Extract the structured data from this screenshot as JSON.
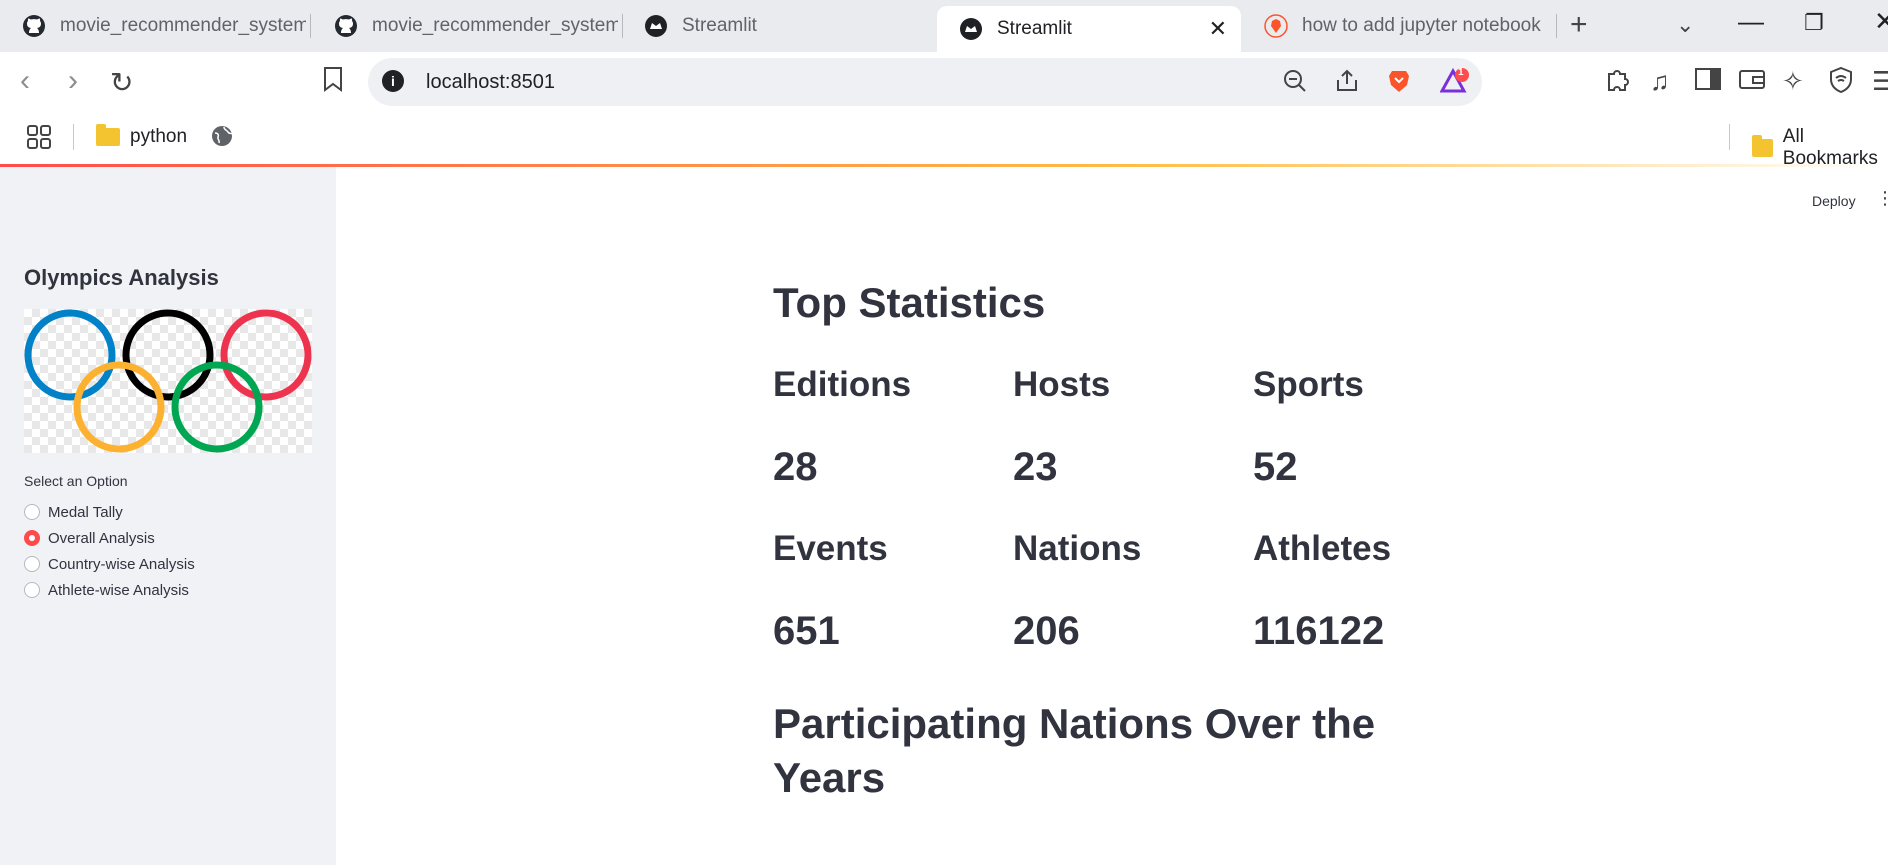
{
  "browser": {
    "tabs": [
      {
        "title": "movie_recommender_system/",
        "icon": "github-icon"
      },
      {
        "title": "movie_recommender_system/",
        "icon": "github-icon"
      },
      {
        "title": "Streamlit",
        "icon": "streamlit-icon"
      },
      {
        "title": "Streamlit",
        "icon": "streamlit-icon",
        "active": true
      },
      {
        "title": "how to add jupyter notebook",
        "icon": "brave-icon"
      }
    ],
    "url": "localhost:8501",
    "notification_count": "1",
    "bookmarks": [
      {
        "label": "python"
      },
      {
        "label": "All Bookmarks"
      }
    ]
  },
  "app": {
    "toolbar": {
      "deploy_label": "Deploy"
    },
    "sidebar": {
      "title": "Olympics Analysis",
      "radio_label": "Select an Option",
      "options": [
        "Medal Tally",
        "Overall Analysis",
        "Country-wise Analysis",
        "Athlete-wise Analysis"
      ],
      "selected": "Overall Analysis"
    },
    "main": {
      "title": "Top Statistics",
      "stats": [
        {
          "label": "Editions",
          "value": "28"
        },
        {
          "label": "Hosts",
          "value": "23"
        },
        {
          "label": "Sports",
          "value": "52"
        },
        {
          "label": "Events",
          "value": "651"
        },
        {
          "label": "Nations",
          "value": "206"
        },
        {
          "label": "Athletes",
          "value": "116122"
        }
      ],
      "subtitle": "Participating Nations Over the Years"
    }
  },
  "colors": {
    "accent": "#ff4b4b",
    "text": "#31333f",
    "sidebar_bg": "#f0f2f6"
  }
}
